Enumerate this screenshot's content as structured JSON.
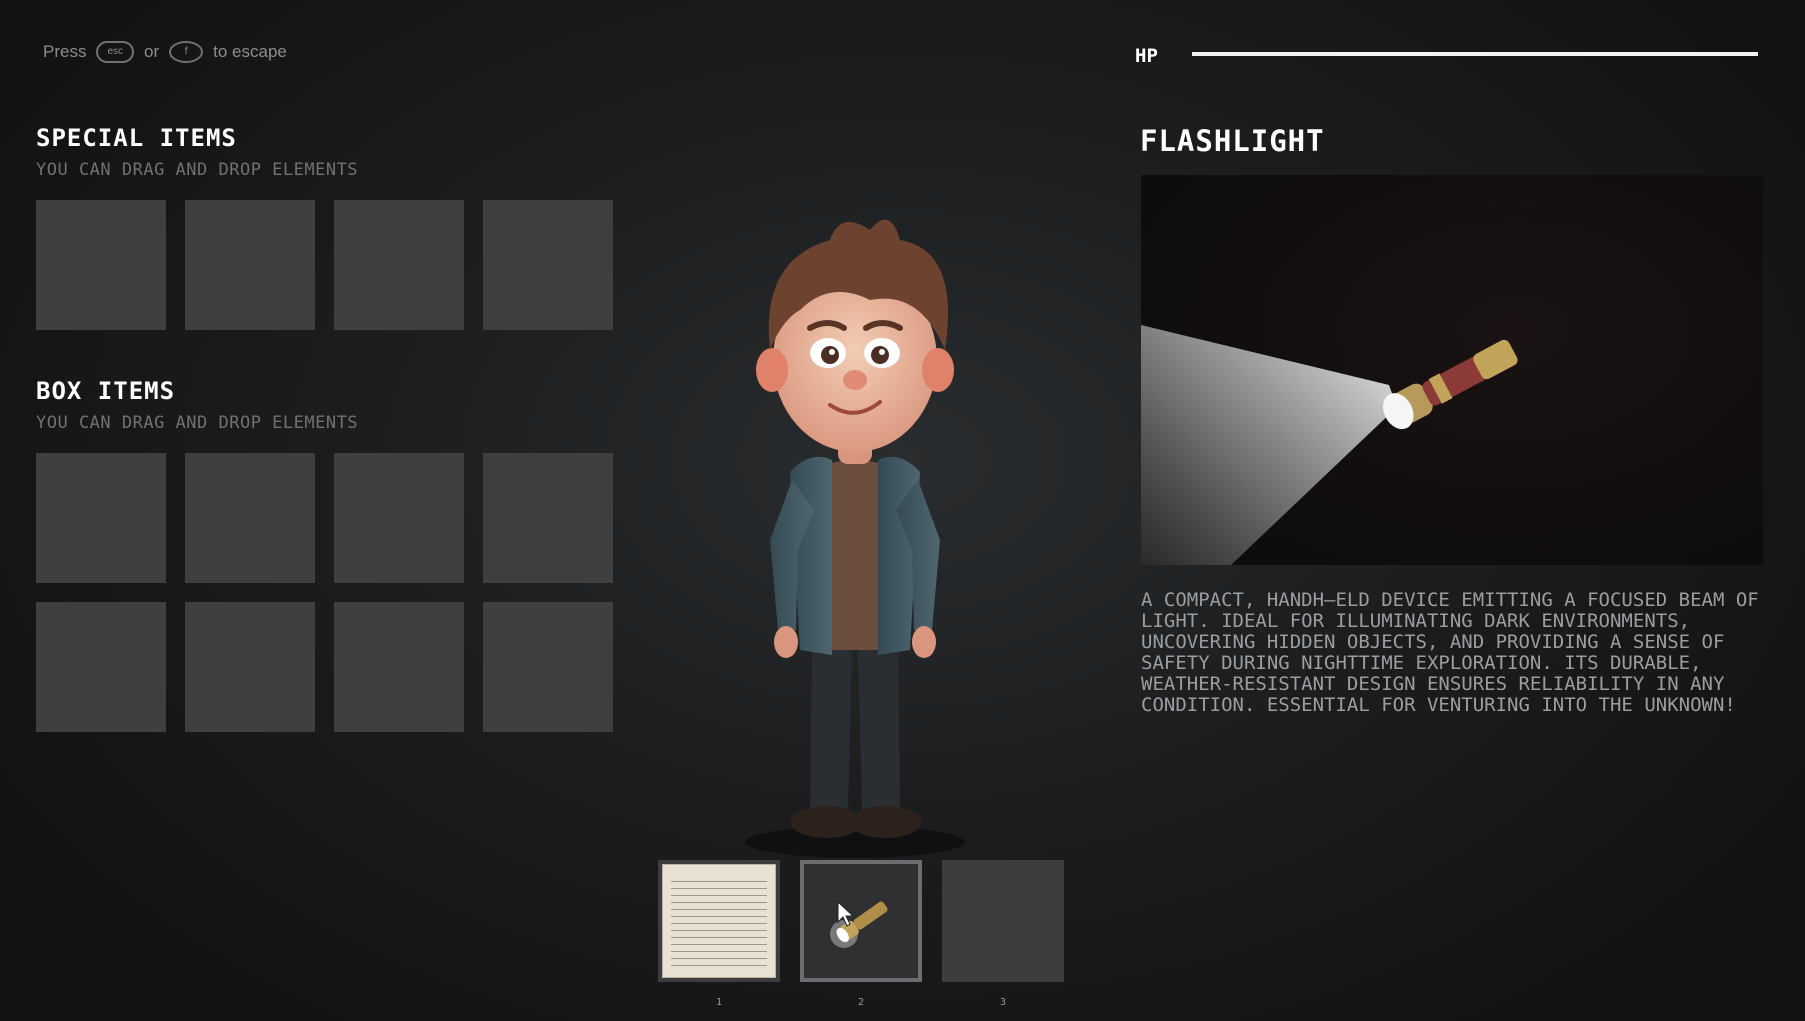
{
  "hint": {
    "press": "Press",
    "key_esc": "esc",
    "or": "or",
    "key_f": "F",
    "to_escape": "to escape"
  },
  "special_items": {
    "title": "SPECIAL ITEMS",
    "subtitle": "YOU CAN DRAG AND DROP ELEMENTS",
    "slots": 4
  },
  "box_items": {
    "title": "BOX ITEMS",
    "subtitle": "YOU CAN DRAG AND DROP ELEMENTS",
    "slots": 8
  },
  "hp": {
    "label": "HP",
    "value": 1.0
  },
  "selected_item": {
    "title": "FLASHLIGHT",
    "image_icon": "flashlight-icon",
    "description": "A COMPACT, HANDH—ELD DEVICE EMITTING A FOCUSED BEAM OF LIGHT. IDEAL FOR ILLUMINATING DARK ENVIRONMENTS, UNCOVERING HIDDEN OBJECTS, AND PROVIDING A SENSE OF SAFETY DURING NIGHTTIME EXPLORATION. ITS DURABLE, WEATHER-RESISTANT DESIGN ENSURES RELIABILITY IN ANY CONDITION. ESSENTIAL FOR VENTURING INTO THE UNKNOWN!"
  },
  "hotbar": [
    {
      "number": "1",
      "icon": "note-icon",
      "selected": false
    },
    {
      "number": "2",
      "icon": "flashlight-icon",
      "selected": true
    },
    {
      "number": "3",
      "icon": "",
      "selected": false
    }
  ],
  "character": {
    "icon": "character-icon"
  },
  "colors": {
    "background": "#1c1e20",
    "slot": "#3e3f41",
    "hp_fill": "#f2f2f2",
    "title": "#ffffff",
    "desc": "#9b9ea1"
  }
}
